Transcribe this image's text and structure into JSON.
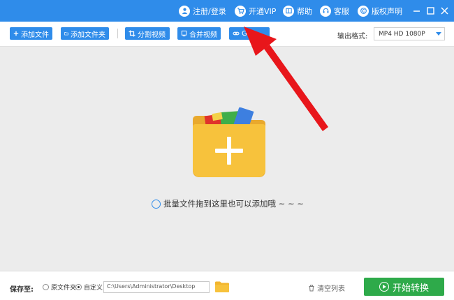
{
  "title_bar": {
    "items": [
      {
        "label": "注册/登录",
        "icon": "user-icon"
      },
      {
        "label": "开通VIP",
        "icon": "cart-icon"
      },
      {
        "label": "帮助",
        "icon": "book-icon"
      },
      {
        "label": "客服",
        "icon": "headset-icon"
      },
      {
        "label": "版权声明",
        "icon": "copyright-icon"
      }
    ],
    "window_controls": [
      "minimize",
      "maximize",
      "close"
    ]
  },
  "toolbar": {
    "buttons": [
      {
        "label": "添加文件",
        "icon": "plus-icon"
      },
      {
        "label": "添加文件夹",
        "icon": "folder-icon"
      },
      {
        "label": "分割视频",
        "icon": "crop-icon"
      },
      {
        "label": "合并视频",
        "icon": "merge-icon"
      },
      {
        "label": "GIF",
        "icon": "link-icon"
      }
    ],
    "output_format_label": "输出格式:",
    "output_format_value": "MP4  HD 1080P"
  },
  "dropzone": {
    "hint": "批量文件拖到这里也可以添加哦 ~ ~ ~"
  },
  "bottom": {
    "save_label": "保存至:",
    "radio_original": "原文件夹",
    "radio_custom": "自定义",
    "selected": "自定义",
    "path": "C:\\Users\\Administrator\\Desktop",
    "clear_label": "清空列表",
    "start_label": "开始转换"
  },
  "colors": {
    "accent": "#2f8cea",
    "start": "#2eaa4a",
    "folder": "#f7c23c",
    "annotation": "#e8161b"
  }
}
